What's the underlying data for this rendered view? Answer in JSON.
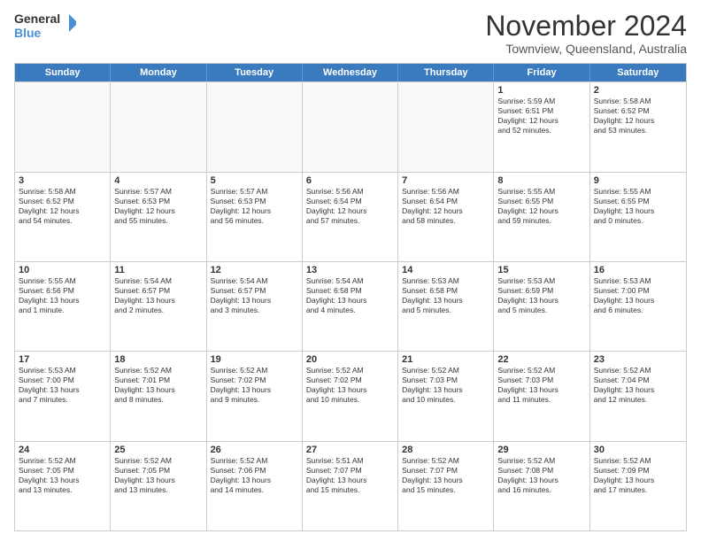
{
  "logo": {
    "line1": "General",
    "line2": "Blue"
  },
  "title": "November 2024",
  "location": "Townview, Queensland, Australia",
  "days": [
    "Sunday",
    "Monday",
    "Tuesday",
    "Wednesday",
    "Thursday",
    "Friday",
    "Saturday"
  ],
  "rows": [
    [
      {
        "day": "",
        "empty": true
      },
      {
        "day": "",
        "empty": true
      },
      {
        "day": "",
        "empty": true
      },
      {
        "day": "",
        "empty": true
      },
      {
        "day": "",
        "empty": true
      },
      {
        "day": "1",
        "text": "Sunrise: 5:59 AM\nSunset: 6:51 PM\nDaylight: 12 hours\nand 52 minutes."
      },
      {
        "day": "2",
        "text": "Sunrise: 5:58 AM\nSunset: 6:52 PM\nDaylight: 12 hours\nand 53 minutes."
      }
    ],
    [
      {
        "day": "3",
        "text": "Sunrise: 5:58 AM\nSunset: 6:52 PM\nDaylight: 12 hours\nand 54 minutes."
      },
      {
        "day": "4",
        "text": "Sunrise: 5:57 AM\nSunset: 6:53 PM\nDaylight: 12 hours\nand 55 minutes."
      },
      {
        "day": "5",
        "text": "Sunrise: 5:57 AM\nSunset: 6:53 PM\nDaylight: 12 hours\nand 56 minutes."
      },
      {
        "day": "6",
        "text": "Sunrise: 5:56 AM\nSunset: 6:54 PM\nDaylight: 12 hours\nand 57 minutes."
      },
      {
        "day": "7",
        "text": "Sunrise: 5:56 AM\nSunset: 6:54 PM\nDaylight: 12 hours\nand 58 minutes."
      },
      {
        "day": "8",
        "text": "Sunrise: 5:55 AM\nSunset: 6:55 PM\nDaylight: 12 hours\nand 59 minutes."
      },
      {
        "day": "9",
        "text": "Sunrise: 5:55 AM\nSunset: 6:55 PM\nDaylight: 13 hours\nand 0 minutes."
      }
    ],
    [
      {
        "day": "10",
        "text": "Sunrise: 5:55 AM\nSunset: 6:56 PM\nDaylight: 13 hours\nand 1 minute."
      },
      {
        "day": "11",
        "text": "Sunrise: 5:54 AM\nSunset: 6:57 PM\nDaylight: 13 hours\nand 2 minutes."
      },
      {
        "day": "12",
        "text": "Sunrise: 5:54 AM\nSunset: 6:57 PM\nDaylight: 13 hours\nand 3 minutes."
      },
      {
        "day": "13",
        "text": "Sunrise: 5:54 AM\nSunset: 6:58 PM\nDaylight: 13 hours\nand 4 minutes."
      },
      {
        "day": "14",
        "text": "Sunrise: 5:53 AM\nSunset: 6:58 PM\nDaylight: 13 hours\nand 5 minutes."
      },
      {
        "day": "15",
        "text": "Sunrise: 5:53 AM\nSunset: 6:59 PM\nDaylight: 13 hours\nand 5 minutes."
      },
      {
        "day": "16",
        "text": "Sunrise: 5:53 AM\nSunset: 7:00 PM\nDaylight: 13 hours\nand 6 minutes."
      }
    ],
    [
      {
        "day": "17",
        "text": "Sunrise: 5:53 AM\nSunset: 7:00 PM\nDaylight: 13 hours\nand 7 minutes."
      },
      {
        "day": "18",
        "text": "Sunrise: 5:52 AM\nSunset: 7:01 PM\nDaylight: 13 hours\nand 8 minutes."
      },
      {
        "day": "19",
        "text": "Sunrise: 5:52 AM\nSunset: 7:02 PM\nDaylight: 13 hours\nand 9 minutes."
      },
      {
        "day": "20",
        "text": "Sunrise: 5:52 AM\nSunset: 7:02 PM\nDaylight: 13 hours\nand 10 minutes."
      },
      {
        "day": "21",
        "text": "Sunrise: 5:52 AM\nSunset: 7:03 PM\nDaylight: 13 hours\nand 10 minutes."
      },
      {
        "day": "22",
        "text": "Sunrise: 5:52 AM\nSunset: 7:03 PM\nDaylight: 13 hours\nand 11 minutes."
      },
      {
        "day": "23",
        "text": "Sunrise: 5:52 AM\nSunset: 7:04 PM\nDaylight: 13 hours\nand 12 minutes."
      }
    ],
    [
      {
        "day": "24",
        "text": "Sunrise: 5:52 AM\nSunset: 7:05 PM\nDaylight: 13 hours\nand 13 minutes."
      },
      {
        "day": "25",
        "text": "Sunrise: 5:52 AM\nSunset: 7:05 PM\nDaylight: 13 hours\nand 13 minutes."
      },
      {
        "day": "26",
        "text": "Sunrise: 5:52 AM\nSunset: 7:06 PM\nDaylight: 13 hours\nand 14 minutes."
      },
      {
        "day": "27",
        "text": "Sunrise: 5:51 AM\nSunset: 7:07 PM\nDaylight: 13 hours\nand 15 minutes."
      },
      {
        "day": "28",
        "text": "Sunrise: 5:52 AM\nSunset: 7:07 PM\nDaylight: 13 hours\nand 15 minutes."
      },
      {
        "day": "29",
        "text": "Sunrise: 5:52 AM\nSunset: 7:08 PM\nDaylight: 13 hours\nand 16 minutes."
      },
      {
        "day": "30",
        "text": "Sunrise: 5:52 AM\nSunset: 7:09 PM\nDaylight: 13 hours\nand 17 minutes."
      }
    ]
  ]
}
